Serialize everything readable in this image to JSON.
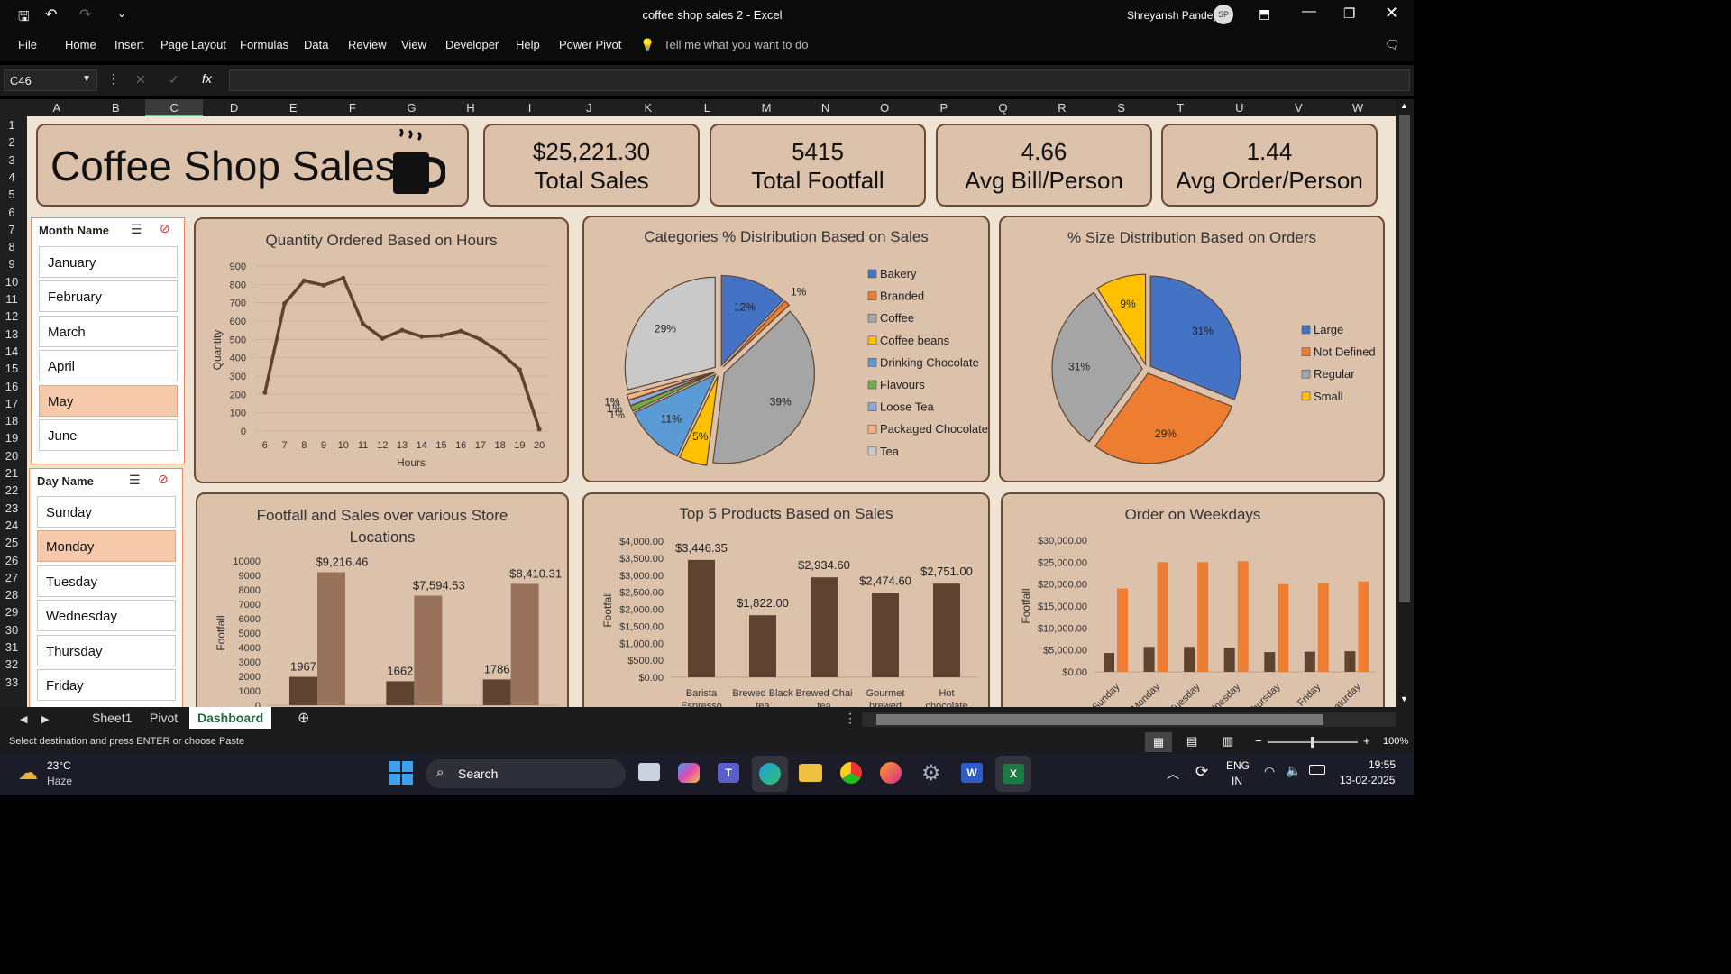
{
  "window": {
    "title": "coffee shop sales 2  -  Excel",
    "user": "Shreyansh Pandey",
    "avatar_initials": "SP"
  },
  "menu": [
    "File",
    "Home",
    "Insert",
    "Page Layout",
    "Formulas",
    "Data",
    "Review",
    "View",
    "Developer",
    "Help",
    "Power Pivot"
  ],
  "tell_me": "Tell me what you want to do",
  "formula": {
    "name_box": "C46",
    "fx": "fx",
    "cancel": "✕",
    "enter": "✓"
  },
  "columns": [
    "A",
    "B",
    "C",
    "D",
    "E",
    "F",
    "G",
    "H",
    "I",
    "J",
    "K",
    "L",
    "M",
    "N",
    "O",
    "P",
    "Q",
    "R",
    "S",
    "T",
    "U",
    "V",
    "W"
  ],
  "rows": [
    "1",
    "2",
    "3",
    "4",
    "5",
    "6",
    "7",
    "8",
    "9",
    "10",
    "11",
    "12",
    "13",
    "14",
    "15",
    "16",
    "17",
    "18",
    "19",
    "20",
    "21",
    "22",
    "23",
    "24",
    "25",
    "26",
    "27",
    "28",
    "29",
    "30",
    "31",
    "32",
    "33"
  ],
  "dashboard": {
    "title": "Coffee Shop Sales",
    "kpis": [
      {
        "value": "$25,221.30",
        "label": "Total Sales"
      },
      {
        "value": "5415",
        "label": "Total Footfall"
      },
      {
        "value": "4.66",
        "label": "Avg Bill/Person"
      },
      {
        "value": "1.44",
        "label": "Avg Order/Person"
      }
    ]
  },
  "slicers": {
    "month": {
      "title": "Month Name",
      "items": [
        "January",
        "February",
        "March",
        "April",
        "May",
        "June"
      ],
      "selected": "May"
    },
    "day": {
      "title": "Day Name",
      "items": [
        "Sunday",
        "Monday",
        "Tuesday",
        "Wednesday",
        "Thursday",
        "Friday"
      ],
      "selected": "Monday"
    }
  },
  "chart_data": [
    {
      "type": "line",
      "title": "Quantity Ordered Based on Hours",
      "xlabel": "Hours",
      "ylabel": "Quantity",
      "x": [
        6,
        7,
        8,
        9,
        10,
        11,
        12,
        13,
        14,
        15,
        16,
        17,
        18,
        19,
        20
      ],
      "y": [
        210,
        695,
        820,
        795,
        835,
        585,
        505,
        550,
        515,
        520,
        545,
        500,
        430,
        335,
        10
      ],
      "yticks": [
        "0",
        "100",
        "200",
        "300",
        "400",
        "500",
        "600",
        "700",
        "800",
        "900"
      ],
      "ylim": [
        0,
        900
      ],
      "color": "#5e4330"
    },
    {
      "type": "pie",
      "title": "Categories % Distribution Based on Sales",
      "legend": [
        "Bakery",
        "Branded",
        "Coffee",
        "Coffee beans",
        "Drinking Chocolate",
        "Flavours",
        "Loose Tea",
        "Packaged Chocolate",
        "Tea"
      ],
      "values": [
        12,
        1,
        39,
        5,
        11,
        1,
        1,
        1,
        29
      ],
      "labels": [
        "12%",
        "1%",
        "39%",
        "5%",
        "11%",
        "1%",
        "1%",
        "1%",
        "29%"
      ],
      "colors": [
        "#4472c4",
        "#ed7d31",
        "#a5a5a5",
        "#ffc000",
        "#5b9bd5",
        "#70ad47",
        "#8ea9db",
        "#f4b183",
        "#c9c9c9"
      ]
    },
    {
      "type": "pie",
      "title": "% Size Distribution Based on Orders",
      "legend": [
        "Large",
        "Not Defined",
        "Regular",
        "Small"
      ],
      "values": [
        31,
        29,
        31,
        9
      ],
      "labels": [
        "31%",
        "29%",
        "31%",
        "9%"
      ],
      "colors": [
        "#4472c4",
        "#ed7d31",
        "#a5a5a5",
        "#ffc000"
      ]
    },
    {
      "type": "bar",
      "title": "Footfall and Sales over various Store Locations",
      "ylabel": "Footfall",
      "yticks": [
        "0",
        "1000",
        "2000",
        "3000",
        "4000",
        "5000",
        "6000",
        "7000",
        "8000",
        "9000",
        "10000"
      ],
      "ylim": [
        0,
        10000
      ],
      "series": [
        {
          "name": "Footfall",
          "values": [
            1967,
            1662,
            1786
          ],
          "labels": [
            "1967",
            "1662",
            "1786"
          ]
        },
        {
          "name": "Sales",
          "values": [
            9216.46,
            7594.53,
            8410.31
          ],
          "labels": [
            "$9,216.46",
            "$7,594.53",
            "$8,410.31"
          ]
        }
      ]
    },
    {
      "type": "bar",
      "title": "Top 5 Products Based on Sales",
      "ylabel": "Footfall",
      "yticks": [
        "$0.00",
        "$500.00",
        "$1,000.00",
        "$1,500.00",
        "$2,000.00",
        "$2,500.00",
        "$3,000.00",
        "$3,500.00",
        "$4,000.00"
      ],
      "ylim": [
        0,
        4000
      ],
      "categories": [
        "Barista Espresso",
        "Brewed Black tea",
        "Brewed Chai tea",
        "Gourmet brewed",
        "Hot chocolate"
      ],
      "values": [
        3446.35,
        1822.0,
        2934.6,
        2474.6,
        2751.0
      ],
      "labels": [
        "$3,446.35",
        "$1,822.00",
        "$2,934.60",
        "$2,474.60",
        "$2,751.00"
      ]
    },
    {
      "type": "bar",
      "title": "Order on Weekdays",
      "ylabel": "Footfall",
      "yticks": [
        "$0.00",
        "$5,000.00",
        "$10,000.00",
        "$15,000.00",
        "$20,000.00",
        "$25,000.00",
        "$30,000.00"
      ],
      "ylim": [
        0,
        30000
      ],
      "categories": [
        "Sunday",
        "Monday",
        "Tuesday",
        "Wednesday",
        "Thursday",
        "Friday",
        "Saturday"
      ],
      "series": [
        {
          "values": [
            4300,
            5700,
            5700,
            5500,
            4500,
            4600,
            4700
          ]
        },
        {
          "values": [
            19000,
            25000,
            25000,
            25200,
            20000,
            20200,
            20600
          ]
        }
      ]
    }
  ],
  "tabs": [
    "Sheet1",
    "Pivot",
    "Dashboard"
  ],
  "active_tab": "Dashboard",
  "status_text": "Select destination and press ENTER or choose Paste",
  "zoom": "100%",
  "taskbar": {
    "weather_temp": "23°C",
    "weather_desc": "Haze",
    "search": "Search",
    "lang1": "ENG",
    "lang2": "IN",
    "time": "19:55",
    "date": "13-02-2025"
  }
}
